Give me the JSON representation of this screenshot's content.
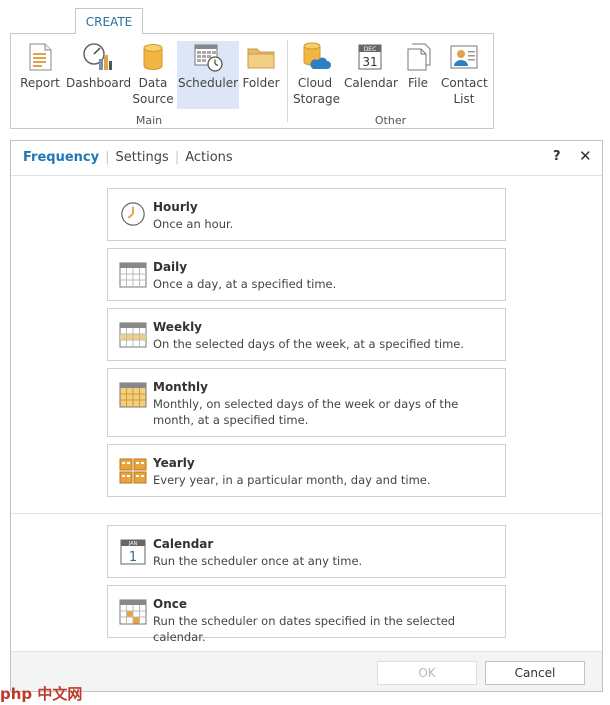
{
  "ribbon": {
    "tab_label": "CREATE",
    "main_group": "Main",
    "other_group": "Other",
    "items": [
      {
        "line1": "Report",
        "line2": ""
      },
      {
        "line1": "Dashboard",
        "line2": ""
      },
      {
        "line1": "Data",
        "line2": "Source"
      },
      {
        "line1": "Scheduler",
        "line2": ""
      },
      {
        "line1": "Folder",
        "line2": ""
      },
      {
        "line1": "Cloud",
        "line2": "Storage"
      },
      {
        "line1": "Calendar",
        "line2": ""
      },
      {
        "line1": "File",
        "line2": ""
      },
      {
        "line1": "Contact",
        "line2": "List"
      }
    ],
    "calendar_icon_month": "DEC",
    "calendar_icon_day": "31"
  },
  "dialog": {
    "tabs": [
      "Frequency",
      "Settings",
      "Actions"
    ],
    "help": "?",
    "close": "✕",
    "options": [
      {
        "title": "Hourly",
        "desc": "Once an hour."
      },
      {
        "title": "Daily",
        "desc": "Once a day, at a specified time."
      },
      {
        "title": "Weekly",
        "desc": "On the selected days of the week, at a specified time."
      },
      {
        "title": "Monthly",
        "desc": "Monthly, on selected days of the week or days of the month, at a specified time."
      },
      {
        "title": "Yearly",
        "desc": "Every year, in a particular month, day and time."
      },
      {
        "title": "Calendar",
        "desc": "Run the scheduler once at any time."
      },
      {
        "title": "Once",
        "desc": "Run the scheduler on dates specified in the selected calendar."
      }
    ],
    "calendar_icon_month": "JAN",
    "calendar_icon_day": "1",
    "ok": "OK",
    "cancel": "Cancel"
  },
  "watermark": "php 中文网",
  "colors": {
    "accent": "#1f78b4",
    "selected_bg": "#dde6f6",
    "calendar_orange": "#e8a33c"
  }
}
